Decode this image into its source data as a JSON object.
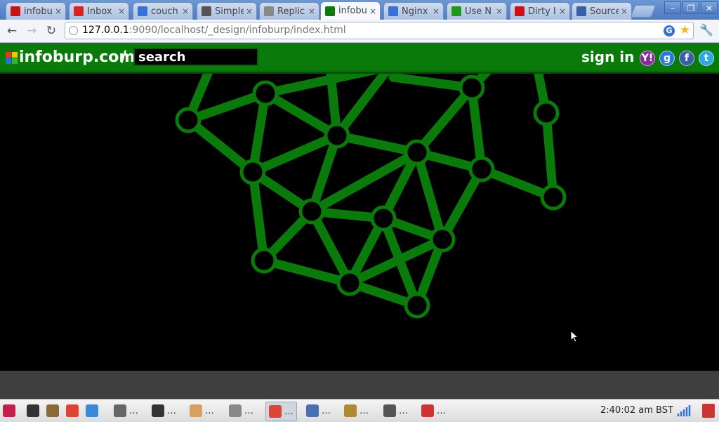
{
  "browser": {
    "tabs": [
      {
        "label": "infobu",
        "icon": "record-icon",
        "color": "#cc1111"
      },
      {
        "label": "Inbox",
        "icon": "gmail-icon",
        "color": "#d22"
      },
      {
        "label": "couch",
        "icon": "google-icon",
        "color": "#3a6fd8"
      },
      {
        "label": "Simple",
        "icon": "eye-icon",
        "color": "#555"
      },
      {
        "label": "Replic",
        "icon": "globe-icon",
        "color": "#888"
      },
      {
        "label": "infobu",
        "icon": "infoburp-icon",
        "color": "#0a7a0a",
        "active": true
      },
      {
        "label": "Nginx",
        "icon": "google-icon",
        "color": "#3a6fd8"
      },
      {
        "label": "Use N",
        "icon": "cube-icon",
        "color": "#1a9a1a"
      },
      {
        "label": "Dirty I",
        "icon": "youtube-icon",
        "color": "#cc1111"
      },
      {
        "label": "Source",
        "icon": "house-icon",
        "color": "#3a5fa8"
      }
    ],
    "url_host": "127.0.0.1",
    "url_rest": ":9090/localhost/_design/infoburp/index.html",
    "win_minimize": "–",
    "win_restore": "❐",
    "win_close": "✕"
  },
  "site": {
    "logo_text": "infoburp.com",
    "slash": "/",
    "search_placeholder": "search",
    "signin_label": "sign in :",
    "social": [
      {
        "name": "yahoo",
        "glyph": "Y!",
        "color": "#8a2a9e"
      },
      {
        "name": "google",
        "glyph": "g",
        "color": "#2a7bd8"
      },
      {
        "name": "facebook",
        "glyph": "f",
        "color": "#3a5fa8"
      },
      {
        "name": "twitter",
        "glyph": "t",
        "color": "#2aa8e0"
      }
    ],
    "graph_color": "#0a7a0a"
  },
  "taskbar": {
    "items": [
      {
        "label": "",
        "icon": "debian-icon"
      },
      {
        "label": "",
        "icon": "terminal-icon"
      },
      {
        "label": "",
        "icon": "paint-icon"
      },
      {
        "label": "",
        "icon": "chrome-icon"
      },
      {
        "label": "",
        "icon": "refresh-icon"
      },
      {
        "label": "…",
        "icon": "tool-icon"
      },
      {
        "label": "…",
        "icon": "terminal-icon"
      },
      {
        "label": "…",
        "icon": "package-icon"
      },
      {
        "label": "…",
        "icon": "gimp-icon"
      },
      {
        "label": "…",
        "icon": "chrome-icon",
        "active": true
      },
      {
        "label": "…",
        "icon": "folder-icon"
      },
      {
        "label": "…",
        "icon": "editor-icon"
      },
      {
        "label": "…",
        "icon": "calculator-icon"
      },
      {
        "label": "…",
        "icon": "network-icon"
      }
    ],
    "clock": "2:40:02 am BST"
  }
}
